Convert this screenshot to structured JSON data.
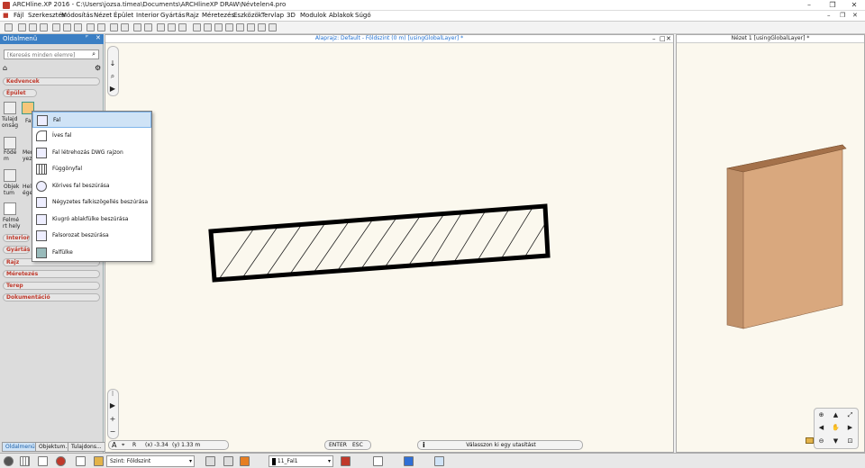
{
  "window": {
    "title": "ARCHline.XP 2016 - C:\\Users\\jozsa.timea\\Documents\\ARCHlineXP DRAW\\Névtelen4.pro",
    "controls": [
      "–",
      "❐",
      "✕"
    ]
  },
  "menu": [
    "Fájl",
    "Szerkesztés",
    "Módosítás",
    "Nézet",
    "Épület",
    "Interior",
    "Gyártás",
    "Rajz",
    "Méretezés",
    "Eszközök",
    "Tervlap",
    "3D",
    "Modulok",
    "Ablakok",
    "Súgó"
  ],
  "mdi_controls": [
    "–",
    "❐",
    "✕"
  ],
  "panel": {
    "title": "Oldalmenü",
    "pin": "ᴾ",
    "close": "✕",
    "search_placeholder": "[Keresés minden elemre]",
    "categories": [
      "Kedvencek",
      "Épület",
      "Interior",
      "Gyártás",
      "Rajz",
      "Méretezés",
      "Terep",
      "Dokumentáció"
    ],
    "tools": [
      {
        "label": "Tulajd onság",
        "icon": "properties-icon"
      },
      {
        "label": "Fa",
        "icon": "wall-icon"
      },
      {
        "label": "Födé m",
        "icon": "slab-icon"
      },
      {
        "label": "Mer yez",
        "icon": "stair-icon"
      },
      {
        "label": "Objek tum",
        "icon": "object-icon"
      },
      {
        "label": "Hely ége",
        "icon": "room-icon"
      },
      {
        "label": "Felmé rt hely",
        "icon": "survey-icon"
      }
    ],
    "tabs": [
      "Oldalmenü",
      "Objektum...",
      "Tulajdons..."
    ]
  },
  "dropdown": {
    "items": [
      {
        "label": "Fal",
        "icon": "wall-icon",
        "selected": true
      },
      {
        "label": "Íves fal",
        "icon": "arc-wall-icon",
        "selected": false
      },
      {
        "label": "Fal létrehozás DWG rajzon",
        "icon": "dwg-wall-icon",
        "selected": false
      },
      {
        "label": "Függönyfal",
        "icon": "curtain-wall-icon",
        "selected": false
      },
      {
        "label": "Körives fal beszúrása",
        "icon": "arc-insert-icon",
        "selected": false
      },
      {
        "label": "Négyzetes falkiszögellés beszúrása",
        "icon": "square-insert-icon",
        "selected": false
      },
      {
        "label": "Kiugró ablakfülke beszúrása",
        "icon": "bay-window-icon",
        "selected": false
      },
      {
        "label": "Falsorozat beszúrása",
        "icon": "wall-series-icon",
        "selected": false
      },
      {
        "label": "Falfülke",
        "icon": "niche-icon",
        "selected": false
      }
    ]
  },
  "viewport_2d": {
    "title": "Alaprajz: Default - Földszint (0 m) [usingGlobalLayer] *",
    "controls": [
      "–",
      "□",
      "✕"
    ]
  },
  "viewport_3d": {
    "title": "Nézet 1 [usingGlobalLayer] *"
  },
  "status": {
    "coord_x": "(x) -3.34",
    "coord_y": "(y) 1.33 m",
    "coord_r": "R",
    "key_enter": "ENTER",
    "key_esc": "ESC",
    "info_icon": "i",
    "message": "Válasszon ki egy utasítást"
  },
  "bottom": {
    "level_label": "Szint:",
    "level_value": "Földszint",
    "layer_value": "11_Fal1"
  },
  "colors": {
    "accent": "#3b7fc4",
    "category_text": "#c0392b",
    "canvas_bg": "#fbf8ee",
    "wall_3d_front": "#d9a87e",
    "wall_3d_side": "#c0916a",
    "wall_3d_top": "#a4714a"
  }
}
